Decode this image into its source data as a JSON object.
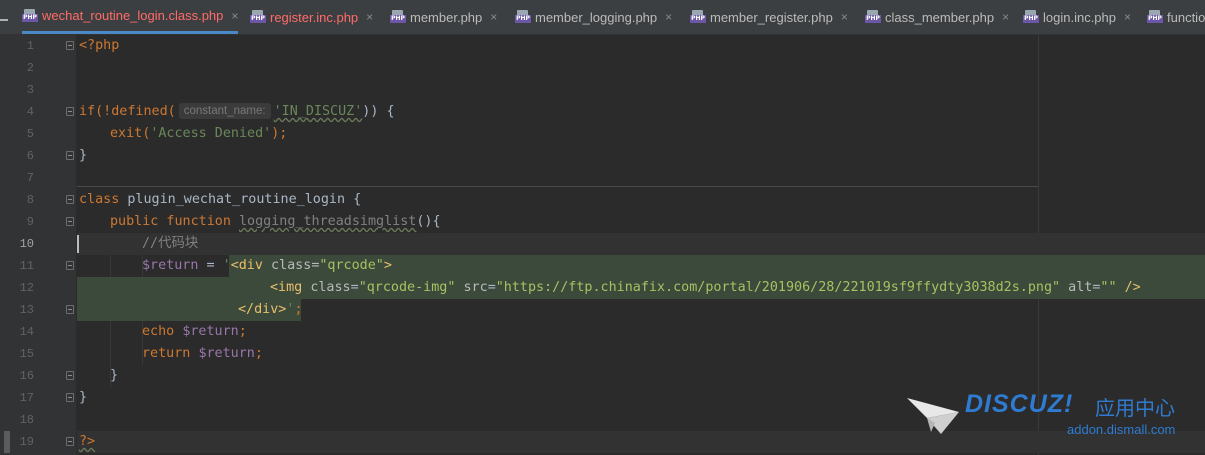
{
  "tabs": [
    {
      "label": "wechat_routine_login.class.php",
      "state": "active"
    },
    {
      "label": "register.inc.php",
      "state": "modified"
    },
    {
      "label": "member.php",
      "state": "normal"
    },
    {
      "label": "member_logging.php",
      "state": "normal"
    },
    {
      "label": "member_register.php",
      "state": "normal"
    },
    {
      "label": "class_member.php",
      "state": "normal"
    },
    {
      "label": "login.inc.php",
      "state": "normal"
    },
    {
      "label": "functio",
      "state": "normal"
    }
  ],
  "tab_icon": "php-file-icon",
  "close_glyph": "×",
  "line_numbers": [
    "1",
    "2",
    "3",
    "4",
    "5",
    "6",
    "7",
    "8",
    "9",
    "10",
    "11",
    "12",
    "13",
    "14",
    "15",
    "16",
    "17",
    "18",
    "19"
  ],
  "current_line": "10",
  "code": {
    "php_open": "<?php",
    "l4_if": "if(!defined(",
    "l4_hint": "constant_name:",
    "l4_str": "'IN_DISCUZ'",
    "l4_end": ")) {",
    "l5_exit": "exit(",
    "l5_str": "'Access Denied'",
    "l5_end": ");",
    "l6": "}",
    "l8_kw": "class",
    "l8_name": " plugin_wechat_routine_login {",
    "l9_kw": "public function",
    "l9_fn": "logging_threadsimglist",
    "l9_end": "(){",
    "l10_cmt": "//代码块",
    "l11_var": "$return",
    "l11_eq": " = ",
    "l11_q": "'",
    "l11_tag_open": "<div ",
    "l11_attr": "class",
    "l11_eq2": "=",
    "l11_val": "\"qrcode\"",
    "l11_close": ">",
    "l12_tag": "<img ",
    "l12_attr1": "class",
    "l12_val1": "\"qrcode-img\"",
    "l12_attr2": "src",
    "l12_val2": "\"https://ftp.chinafix.com/portal/201906/28/221019sf9ffydty3038d2s.png\"",
    "l12_attr3": "alt",
    "l12_val3": "\"\"",
    "l12_end": " />",
    "l13_tag": "</div>",
    "l13_q": "'",
    "l13_end": ";",
    "l14_kw": "echo",
    "l14_var": "$return",
    "l14_end": ";",
    "l15_kw": "return",
    "l15_var": "$return",
    "l15_end": ";",
    "l16": "}",
    "l17": "}",
    "php_close": "?>"
  },
  "watermark": {
    "brand": "DISCUZ!",
    "cn": "应用中心",
    "domain": "addon.dismall.com"
  },
  "colors": {
    "background": "#2b2b2b",
    "keyword": "#cc7832",
    "string": "#6a8759",
    "variable": "#9876aa",
    "active_tab_text": "#ff6b68",
    "watermark": "#2f7bd1"
  }
}
